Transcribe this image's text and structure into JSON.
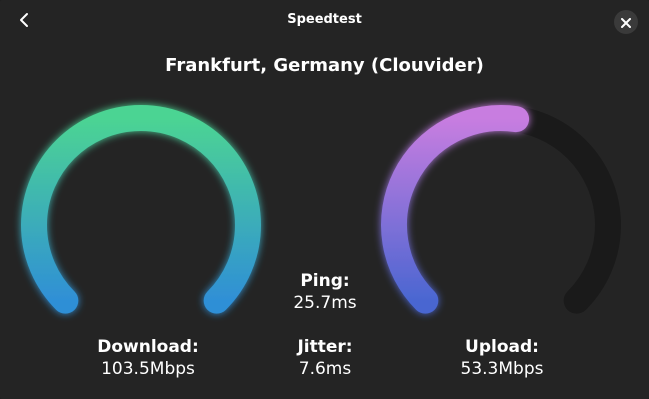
{
  "header": {
    "title": "Speedtest",
    "back_icon": "chevron-left-icon",
    "close_icon": "close-icon"
  },
  "server": "Frankfurt, Germany (Clouvider)",
  "download": {
    "label": "Download:",
    "value": "103.5Mbps",
    "gauge_fraction": 1.0,
    "colors": [
      "#2f8fd6",
      "#4cd493"
    ]
  },
  "upload": {
    "label": "Upload:",
    "value": "53.3Mbps",
    "gauge_fraction": 0.53,
    "colors": [
      "#4a66d1",
      "#c87de0"
    ],
    "track_color": "#1a1a1a"
  },
  "ping": {
    "label": "Ping:",
    "value": "25.7ms"
  },
  "jitter": {
    "label": "Jitter:",
    "value": "7.6ms"
  }
}
